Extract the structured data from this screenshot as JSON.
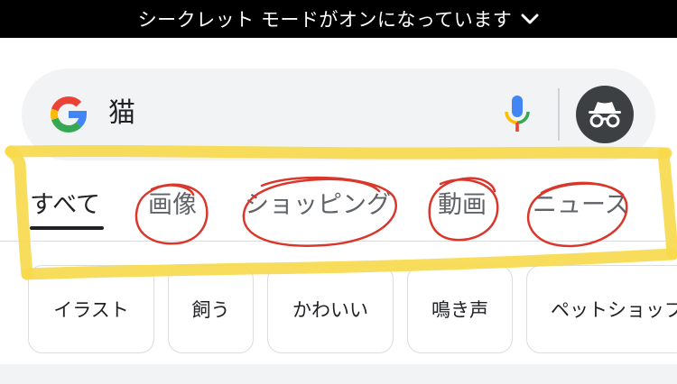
{
  "banner": {
    "text": "シークレット モードがオンになっています"
  },
  "search": {
    "query": "猫"
  },
  "tabs": [
    {
      "label": "すべて",
      "active": true
    },
    {
      "label": "画像",
      "active": false
    },
    {
      "label": "ショッピング",
      "active": false
    },
    {
      "label": "動画",
      "active": false
    },
    {
      "label": "ニュース",
      "active": false
    }
  ],
  "chips": [
    {
      "label": "イラスト"
    },
    {
      "label": "飼う"
    },
    {
      "label": "かわいい"
    },
    {
      "label": "鳴き声"
    },
    {
      "label": "ペットショップ"
    }
  ],
  "icons": {
    "banner_chevron": "chevron-down-icon",
    "logo": "google-g-icon",
    "mic": "microphone-icon",
    "incognito": "incognito-icon"
  },
  "colors": {
    "banner_bg": "#000000",
    "search_bg": "#f1f3f4",
    "annotation_yellow": "#f7d94a",
    "annotation_red": "#d9372c",
    "google_blue": "#4285f4",
    "google_red": "#ea4335",
    "google_yellow": "#fbbc05",
    "google_green": "#34a853"
  }
}
